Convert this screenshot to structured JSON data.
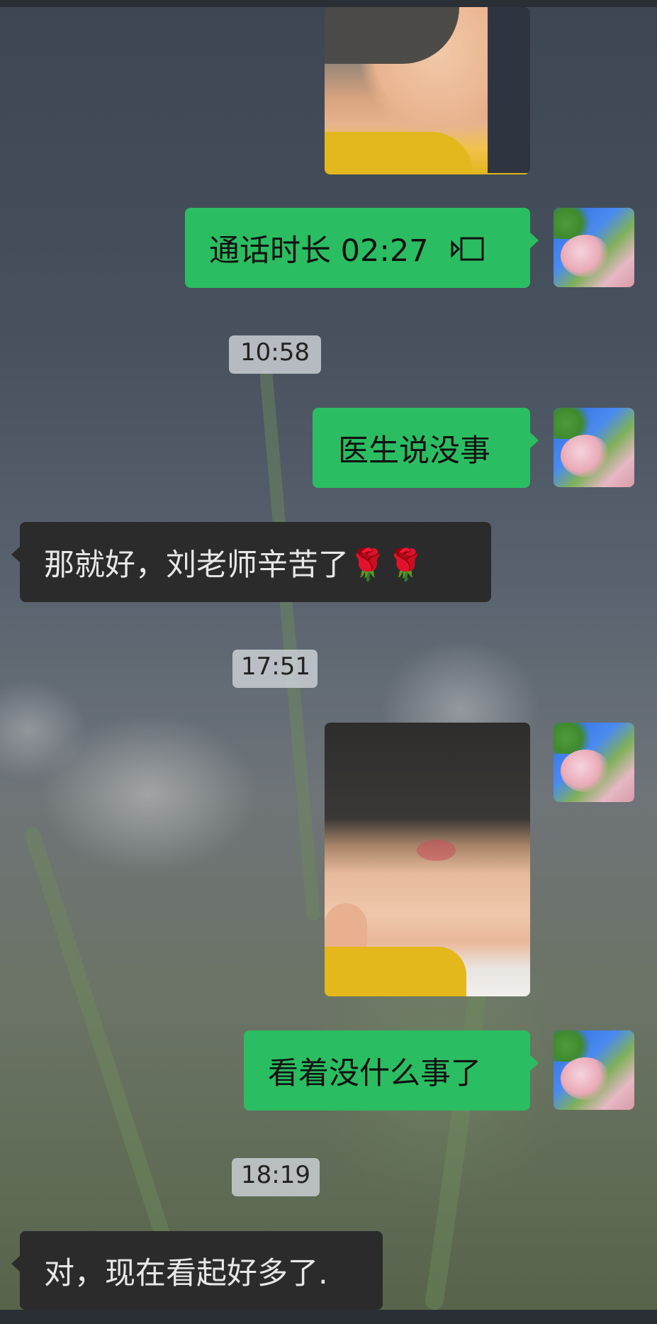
{
  "messages": {
    "call": {
      "text": "通话时长 02:27"
    },
    "ts1": "10:58",
    "m1": "医生说没事",
    "m2": "那就好，刘老师辛苦了🌹🌹",
    "ts2": "17:51",
    "m3": "看着没什么事了",
    "ts3": "18:19",
    "m4": "对，现在看起好多了."
  },
  "colors": {
    "outgoing_bubble": "#2bbd61",
    "incoming_bubble": "#2b2b2b",
    "timestamp_pill": "#cdd2d7"
  },
  "icons": {
    "call": "video-call-icon"
  }
}
